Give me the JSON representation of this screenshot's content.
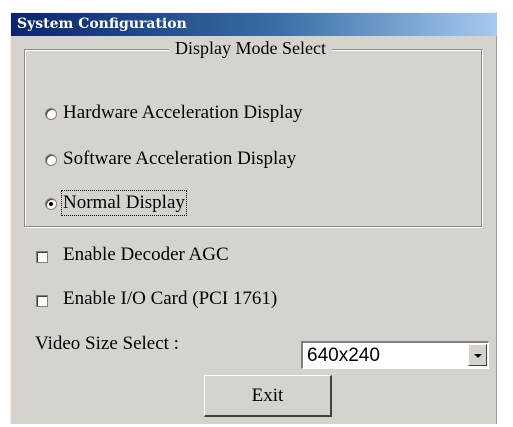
{
  "window": {
    "title": "System Configuration"
  },
  "display_mode": {
    "legend": "Display Mode Select",
    "options": [
      {
        "label": "Hardware Acceleration Display",
        "selected": false
      },
      {
        "label": "Software Acceleration Display",
        "selected": false
      },
      {
        "label": "Normal Display",
        "selected": true
      }
    ]
  },
  "checkboxes": [
    {
      "label": "Enable Decoder AGC",
      "checked": false
    },
    {
      "label": "Enable I/O Card (PCI 1761)",
      "checked": false
    }
  ],
  "video_size": {
    "label": "Video Size Select :",
    "value": "640x240"
  },
  "buttons": {
    "exit": "Exit"
  },
  "colors": {
    "face": "#d6d3ce",
    "title_start": "#0a246a",
    "title_end": "#a6caf0"
  }
}
